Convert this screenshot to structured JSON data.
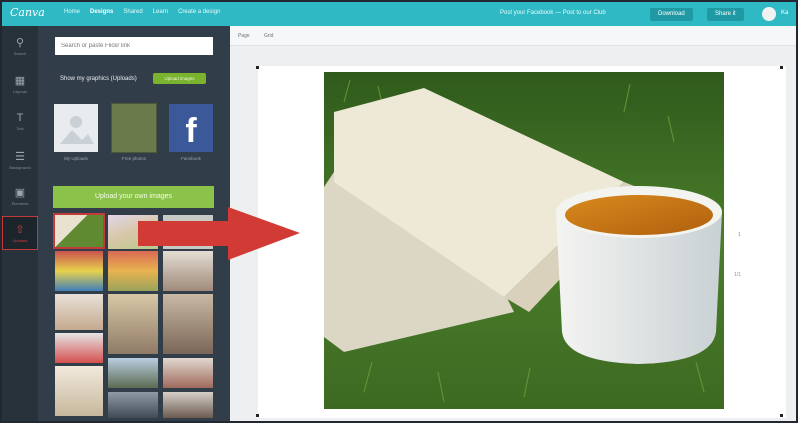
{
  "topbar": {
    "logo": "Canva",
    "nav": [
      {
        "label": "Home",
        "active": false
      },
      {
        "label": "Designs",
        "active": true
      },
      {
        "label": "Shared",
        "active": false
      },
      {
        "label": "Learn",
        "active": false
      },
      {
        "label": "Create a design",
        "active": false
      }
    ],
    "doc_title": "Post your Facebook — Post to our Club",
    "buttons": [
      "Download",
      "Share it"
    ],
    "user": "Ka"
  },
  "rail": [
    {
      "icon": "search-icon",
      "label": "Search"
    },
    {
      "icon": "layout-icon",
      "label": "Layouts"
    },
    {
      "icon": "text-icon",
      "label": "Text"
    },
    {
      "icon": "background-icon",
      "label": "Background"
    },
    {
      "icon": "elements-icon",
      "label": "Elements"
    },
    {
      "icon": "uploads-icon",
      "label": "Uploads",
      "active": true
    }
  ],
  "panel": {
    "search_placeholder": "Search or paste Flickr link",
    "filter_label": "Show my graphics (Uploads)",
    "toggle_label": "Upload images",
    "tiles": [
      {
        "caption": "My Uploads",
        "color": "#e9ecef"
      },
      {
        "caption": "Free photos",
        "color": "#6b7a4a"
      },
      {
        "caption": "Facebook",
        "color": "#3b5998"
      }
    ],
    "upload_button": "Upload your own images"
  },
  "canvas": {
    "ruler_labels": [
      "Page",
      "Grid"
    ],
    "page_marks": [
      "1",
      "1/1"
    ]
  },
  "colors": {
    "brand": "#2fb9c4",
    "accent_green": "#8bc34a",
    "highlight_red": "#c23a3a"
  }
}
